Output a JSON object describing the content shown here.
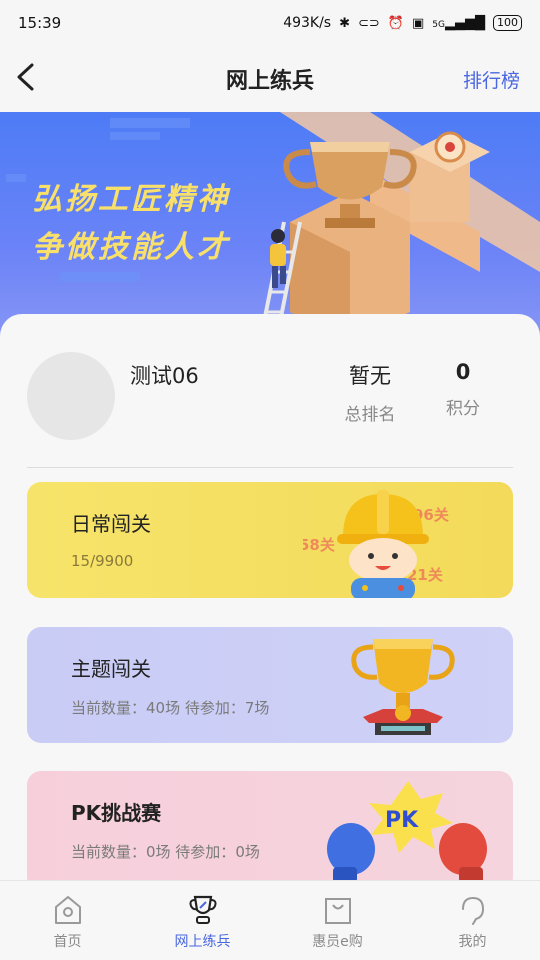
{
  "status_bar": {
    "time": "15:39",
    "network_speed": "493K/s",
    "signal": "5G",
    "battery": "100"
  },
  "nav": {
    "title": "网上练兵",
    "right_label": "排行榜"
  },
  "banner": {
    "slogan_line1": "弘扬工匠精神",
    "slogan_line2": "争做技能人才"
  },
  "profile": {
    "username": "测试06",
    "rank_value": "暂无",
    "rank_label": "总排名",
    "points_value": "0",
    "points_label": "积分"
  },
  "cards": {
    "daily": {
      "title": "日常闯关",
      "progress": "15/9900",
      "badges": [
        "96关",
        "58关",
        "21关"
      ]
    },
    "topic": {
      "title": "主题闯关",
      "status": "当前数量：40场 待参加：7场"
    },
    "pk": {
      "title": "PK挑战赛",
      "status": "当前数量：0场 待参加：0场",
      "badge": "PK"
    }
  },
  "tab_bar": {
    "items": [
      {
        "label": "首页",
        "icon": "home-icon"
      },
      {
        "label": "网上练兵",
        "icon": "trophy-icon"
      },
      {
        "label": "惠员e购",
        "icon": "shopping-bag-icon"
      },
      {
        "label": "我的",
        "icon": "profile-icon"
      }
    ],
    "active_index": 1
  },
  "colors": {
    "accent": "#4a67e0",
    "banner_blue": "#4d7cf6",
    "slogan_yellow": "#f8e06a"
  }
}
